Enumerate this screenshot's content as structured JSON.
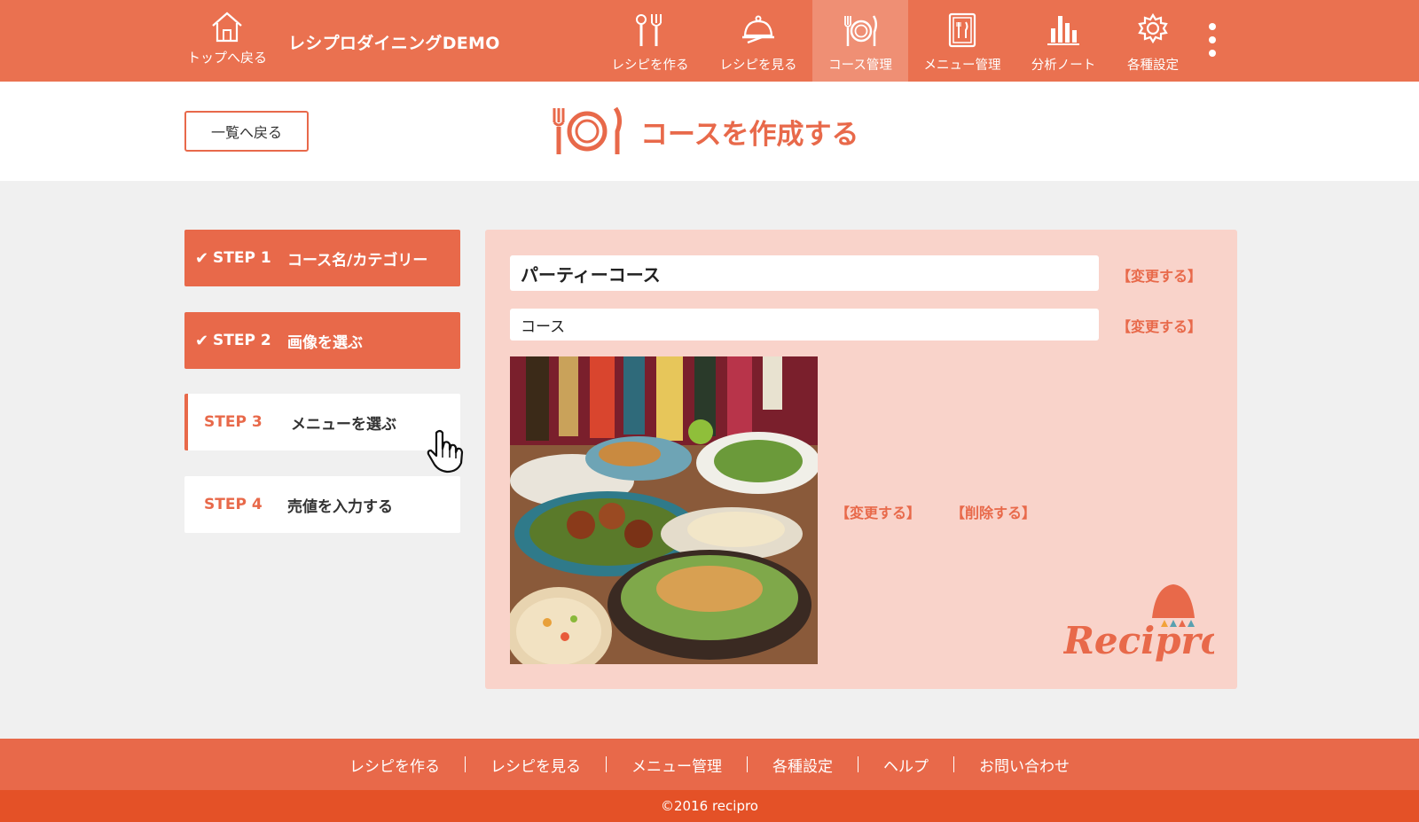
{
  "header": {
    "home_label": "トップへ戻る",
    "brand": "レシプロダイニングDEMO",
    "nav": [
      {
        "label": "レシピを作る",
        "icon": "utensils-icon"
      },
      {
        "label": "レシピを見る",
        "icon": "cloche-icon"
      },
      {
        "label": "コース管理",
        "icon": "plate-icon",
        "active": true
      },
      {
        "label": "メニュー管理",
        "icon": "menu-book-icon"
      },
      {
        "label": "分析ノート",
        "icon": "bar-chart-icon"
      },
      {
        "label": "各種設定",
        "icon": "gear-icon"
      }
    ]
  },
  "title_band": {
    "back_label": "一覧へ戻る",
    "title": "コースを作成する"
  },
  "steps": [
    {
      "num": "STEP 1",
      "name": "コース名/カテゴリー",
      "state": "done"
    },
    {
      "num": "STEP 2",
      "name": "画像を選ぶ",
      "state": "done"
    },
    {
      "num": "STEP 3",
      "name": "メニューを選ぶ",
      "state": "current"
    },
    {
      "num": "STEP 4",
      "name": "売値を入力する",
      "state": "todo"
    }
  ],
  "step_check": "✔",
  "course": {
    "name": "パーティーコース",
    "category": "コース",
    "change_label": "【変更する】",
    "image_change_label": "【変更する】",
    "image_delete_label": "【削除する】"
  },
  "logo_text": "Recipro",
  "footer": {
    "links": [
      "レシピを作る",
      "レシピを見る",
      "メニュー管理",
      "各種設定",
      "ヘルプ",
      "お問い合わせ"
    ],
    "copyright": "©2016 recipro"
  },
  "colors": {
    "header": "#ea7150",
    "accent": "#e8694a",
    "panel": "#f9d3ca",
    "copyright_bar": "#e45127"
  }
}
